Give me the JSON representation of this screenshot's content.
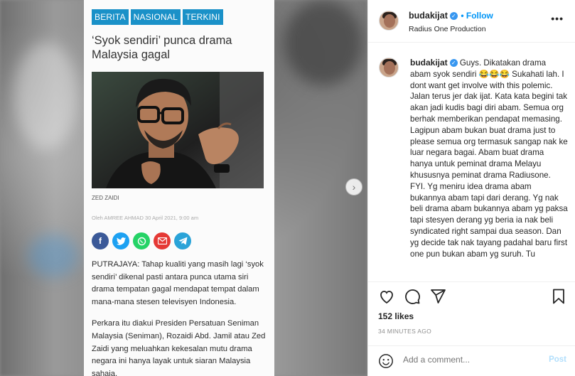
{
  "article": {
    "tags": [
      "BERITA",
      "NASIONAL",
      "TERKINI"
    ],
    "headline": "‘Syok sendiri’ punca drama Malaysia gagal",
    "photo_caption": "ZED ZAIDI",
    "byline": "Oleh AMREE AHMAD   30 April 2021, 9:00 am",
    "share_icons": [
      "facebook-icon",
      "twitter-icon",
      "whatsapp-icon",
      "email-icon",
      "telegram-icon"
    ],
    "share_colors": [
      "#3b5998",
      "#1da1f2",
      "#25d366",
      "#e53935",
      "#2aa3d8"
    ],
    "paragraph1": "PUTRAJAYA: Tahap kualiti yang masih lagi ‘syok sendiri’ dikenal pasti antara punca utama siri drama tempatan gagal mendapat tempat dalam mana-mana stesen televisyen Indonesia.",
    "paragraph2": "Perkara itu diakui Presiden Persatuan Seniman Malaysia (Seniman), Rozaidi Abd. Jamil atau Zed Zaidi yang meluahkan kekesalan mutu drama negara ini hanya layak untuk siaran Malaysia sahaja."
  },
  "media": {
    "next_label": "›"
  },
  "post": {
    "username": "budakijat",
    "verified_mark": "✓",
    "follow_label": "• Follow",
    "location": "Radius One Production",
    "more_label": "•••",
    "caption_user": "budakijat",
    "caption": " Guys. Dikatakan drama abam syok sendiri 😂😂😂 Sukahati lah. I dont want get involve with this polemic. Jalan terus jer dak ijat. Kata kata begini tak akan jadi kudis bagi diri abam. Semua org berhak memberikan pendapat memasing. Lagipun abam bukan buat drama just to please semua org termasuk sangap nak ke luar negara bagai. Abam buat drama hanya untuk peminat drama Melayu khususnya peminat drama Radiusone. FYI. Yg meniru idea drama abam bukannya abam tapi dari derang. Yg nak beli drama abam bukannya abam yg paksa tapi stesyen derang yg beria ia nak beli syndicated right sampai dua season. Dan yg decide tak nak tayang padahal baru first one pun bukan abam yg suruh. Tu",
    "likes": "152 likes",
    "time": "34 MINUTES AGO",
    "comment_placeholder": "Add a comment...",
    "post_label": "Post",
    "accent": "#0095f6"
  }
}
